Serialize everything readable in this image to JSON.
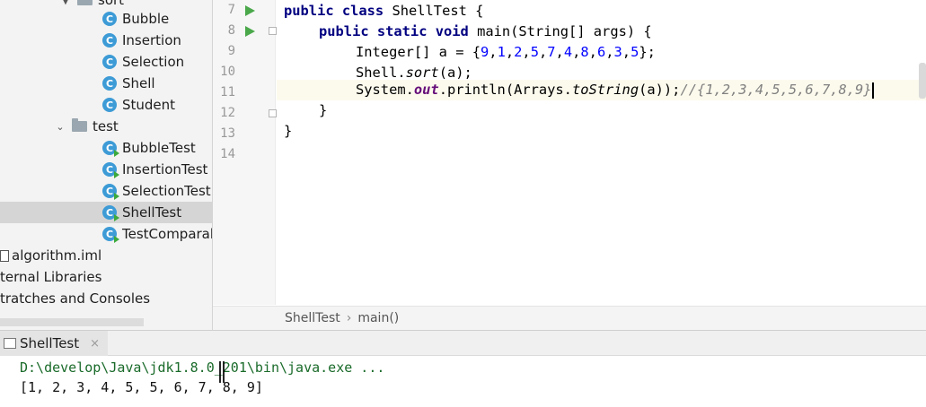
{
  "project_tree": {
    "items": [
      {
        "label": "sort",
        "type": "folder"
      },
      {
        "label": "Bubble",
        "type": "class"
      },
      {
        "label": "Insertion",
        "type": "class"
      },
      {
        "label": "Selection",
        "type": "class"
      },
      {
        "label": "Shell",
        "type": "class"
      },
      {
        "label": "Student",
        "type": "class"
      },
      {
        "label": "test",
        "type": "folder"
      },
      {
        "label": "BubbleTest",
        "type": "test-class"
      },
      {
        "label": "InsertionTest",
        "type": "test-class"
      },
      {
        "label": "SelectionTest",
        "type": "test-class"
      },
      {
        "label": "ShellTest",
        "type": "test-class",
        "selected": true
      },
      {
        "label": "TestComparab",
        "type": "test-class"
      },
      {
        "label": "algorithm.iml",
        "type": "file"
      },
      {
        "label": "ternal Libraries",
        "type": "library"
      },
      {
        "label": "tratches and Consoles",
        "type": "scratches"
      }
    ],
    "class_icon_letter": "C"
  },
  "editor": {
    "line_numbers": [
      "7",
      "8",
      "9",
      "10",
      "11",
      "12",
      "13",
      "14"
    ],
    "current_line": "11",
    "code": {
      "l7_kw": "public class",
      "l7_rest": " ShellTest {",
      "l8_kw": "public static void",
      "l8_rest": " main(String[] args) {",
      "l9_a": "Integer[] a = {",
      "l9_nums": [
        "9",
        "1",
        "2",
        "5",
        "7",
        "4",
        "8",
        "6",
        "3",
        "5"
      ],
      "l9_end": "};",
      "l10_a": "Shell.",
      "l10_m": "sort",
      "l10_b": "(a);",
      "l11_a": "System.",
      "l11_f": "out",
      "l11_b": ".println(Arrays.",
      "l11_m": "toString",
      "l11_c": "(a));",
      "l11_comment": "//{1,2,3,4,5,5,6,7,8,9}",
      "l12": "}",
      "l13": "}"
    }
  },
  "breadcrumb": {
    "items": [
      "ShellTest",
      "main()"
    ],
    "separator": "›"
  },
  "run_panel": {
    "tab_label": "ShellTest",
    "close_glyph": "×",
    "command": "D:\\develop\\Java\\jdk1.8.0_201\\bin\\java.exe ...",
    "output": "[1, 2, 3, 4, 5, 5, 6, 7, 8, 9]"
  },
  "colors": {
    "keyword": "#000080",
    "number": "#0000ff",
    "field": "#660e7a",
    "comment": "#808080",
    "class_icon": "#3d9bd6",
    "run_icon": "#4aa84a",
    "console_command": "#1a6b2a"
  }
}
